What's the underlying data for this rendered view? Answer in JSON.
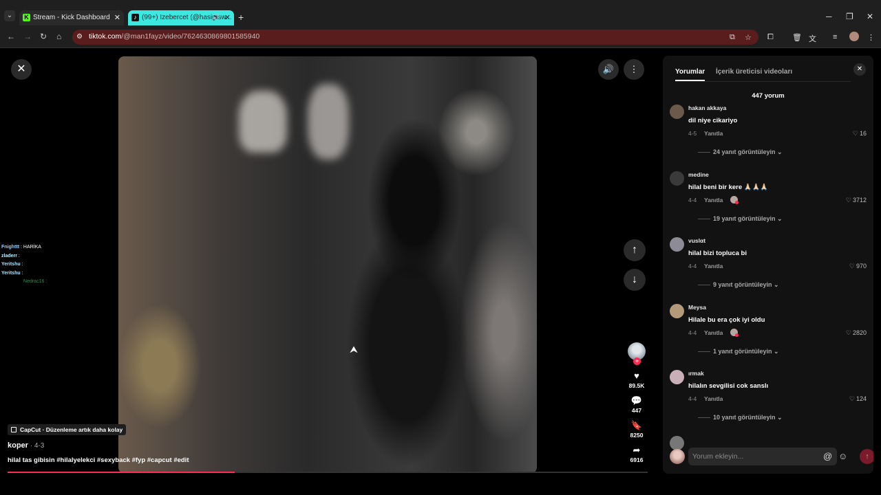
{
  "browser": {
    "tabs": [
      {
        "title": "Stream - Kick Dashboard",
        "favicon": "K",
        "active": false
      },
      {
        "title": "(99+) Izebercet (@hasimsw...",
        "favicon": "♪",
        "active": true
      }
    ],
    "url_host": "tiktok.com",
    "url_path": "/@man1fayz/video/7624630869801585940",
    "accent_color": "#3ce8e0",
    "omnibox_color": "#5a1d1d"
  },
  "chat": [
    {
      "name": "Fnighttt",
      "message": ": HARİKA"
    },
    {
      "name": "zladerr",
      "message": ":"
    },
    {
      "name": "Yeritshu",
      "message": ":"
    },
    {
      "name": "Yeritshu",
      "message": ":"
    },
    {
      "name": "",
      "message": "Nedrac16 :"
    }
  ],
  "video": {
    "capcut_label": "CapCut · Düzenleme artık daha kolay",
    "author": "koper",
    "date": " · 4-3",
    "caption": "hilal tas gibisin #hilalyelekci  #sexyback #fyp #capcut #edit",
    "progress": 0.355
  },
  "actions": {
    "likes": "89.5K",
    "comments": "447",
    "saves": "8250",
    "shares": "6916"
  },
  "panel": {
    "tab_comments": "Yorumlar",
    "tab_creator_videos": "İçerik üreticisi videoları",
    "comment_count": "447 yorum",
    "reply_label": "Yanıtla",
    "input_placeholder": "Yorum ekleyin...",
    "comments": [
      {
        "user": "hakan akkaya",
        "text": "dil niye cikariyo",
        "date": "4-5",
        "likes": "16",
        "views": "24 yanıt görüntüleyin",
        "creator_liked": false,
        "avatar_color": "#6b5a4c"
      },
      {
        "user": "medine",
        "text": "hilal beni bir kere 🙏🏻🙏🏻🙏🏻",
        "date": "4-4",
        "likes": "3712",
        "views": "19 yanıt görüntüleyin",
        "creator_liked": true,
        "avatar_color": "#3a3a3a"
      },
      {
        "user": "vuslαt",
        "text": "hilal bizi topluca bi",
        "date": "4-4",
        "likes": "970",
        "views": "9 yanıt görüntüleyin",
        "creator_liked": false,
        "avatar_color": "#8d8c96"
      },
      {
        "user": "Meysa",
        "text": "Hilale bu era çok iyi oldu",
        "date": "4-4",
        "likes": "2820",
        "views": "1 yanıt görüntüleyin",
        "creator_liked": true,
        "avatar_color": "#b59a7a"
      },
      {
        "user": "ırmak",
        "text": "hilalın sevgilisi cok sanslı",
        "date": "4-4",
        "likes": "124",
        "views": "10 yanıt görüntüleyin",
        "creator_liked": false,
        "avatar_color": "#c9b0b8"
      }
    ]
  }
}
